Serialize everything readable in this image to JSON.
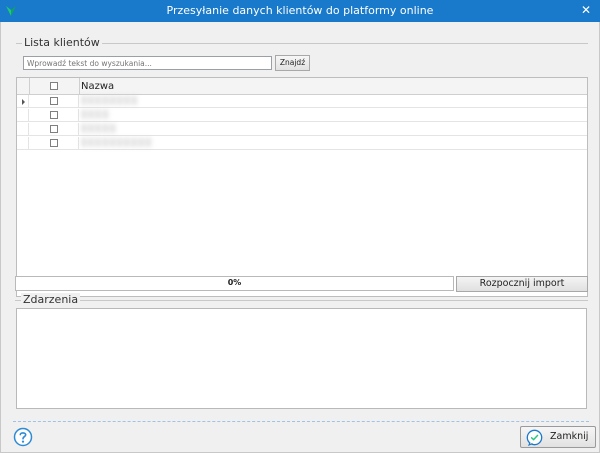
{
  "window": {
    "title": "Przesyłanie danych klientów do platformy online",
    "close_glyph": "✕"
  },
  "clients": {
    "legend": "Lista klientów",
    "search_placeholder": "Wprowadź tekst do wyszukania...",
    "search_button": "Znajdź",
    "columns": {
      "name": "Nazwa"
    },
    "rows": [
      {
        "name": "▒▒▒▒▒▒▒▒",
        "checked": false,
        "current": true
      },
      {
        "name": "▒▒▒▒",
        "checked": false,
        "current": false
      },
      {
        "name": "▒▒▒▒▒",
        "checked": false,
        "current": false
      },
      {
        "name": "▒▒▒▒▒▒▒▒▒▒",
        "checked": false,
        "current": false
      }
    ]
  },
  "progress": {
    "value": 0,
    "label": "0%"
  },
  "import_button": "Rozpocznij import",
  "events": {
    "legend": "Zdarzenia",
    "log": ""
  },
  "footer": {
    "close_button": "Zamknij"
  },
  "icons": {
    "app": "app-logo-icon",
    "help": "help-icon",
    "close_button_icon": "chat-bubble-icon"
  },
  "colors": {
    "titlebar": "#1979ca",
    "accent": "#1979ca",
    "help": "#2e8bd6"
  }
}
